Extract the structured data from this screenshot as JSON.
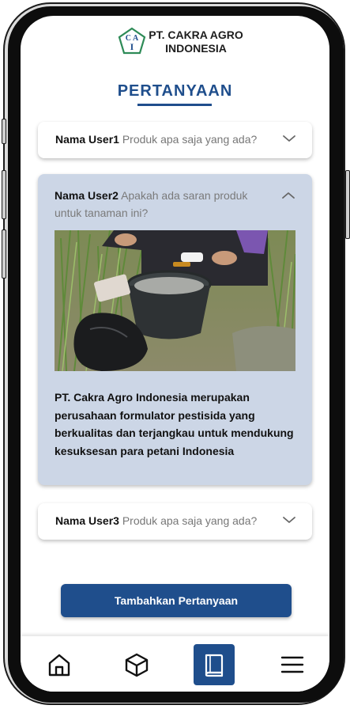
{
  "header": {
    "logo_letters": "CAI",
    "company_line1": "PT. CAKRA AGRO",
    "company_line2": "INDONESIA"
  },
  "page": {
    "title": "PERTANYAAN"
  },
  "questions": [
    {
      "user": "Nama User1",
      "text": "Produk apa saja yang ada?",
      "expanded": false
    },
    {
      "user": "Nama User2",
      "text": "Apakah ada saran produk untuk tanaman ini?",
      "expanded": true,
      "answer": "PT. Cakra Agro Indonesia merupakan perusahaan formulator pestisida yang berkualitas dan terjangkau untuk mendukung kesuksesan para petani Indonesia"
    },
    {
      "user": "Nama User3",
      "text": "Produk apa saja yang ada?",
      "expanded": false
    }
  ],
  "actions": {
    "add_question": "Tambahkan Pertanyaan"
  },
  "nav": {
    "items": [
      {
        "icon": "home-icon",
        "active": false
      },
      {
        "icon": "box-icon",
        "active": false
      },
      {
        "icon": "book-icon",
        "active": true
      },
      {
        "icon": "menu-icon",
        "active": false
      }
    ]
  },
  "colors": {
    "primary": "#1f4e8c",
    "expanded_card": "#ccd6e6",
    "logo_green": "#2e8b57"
  }
}
